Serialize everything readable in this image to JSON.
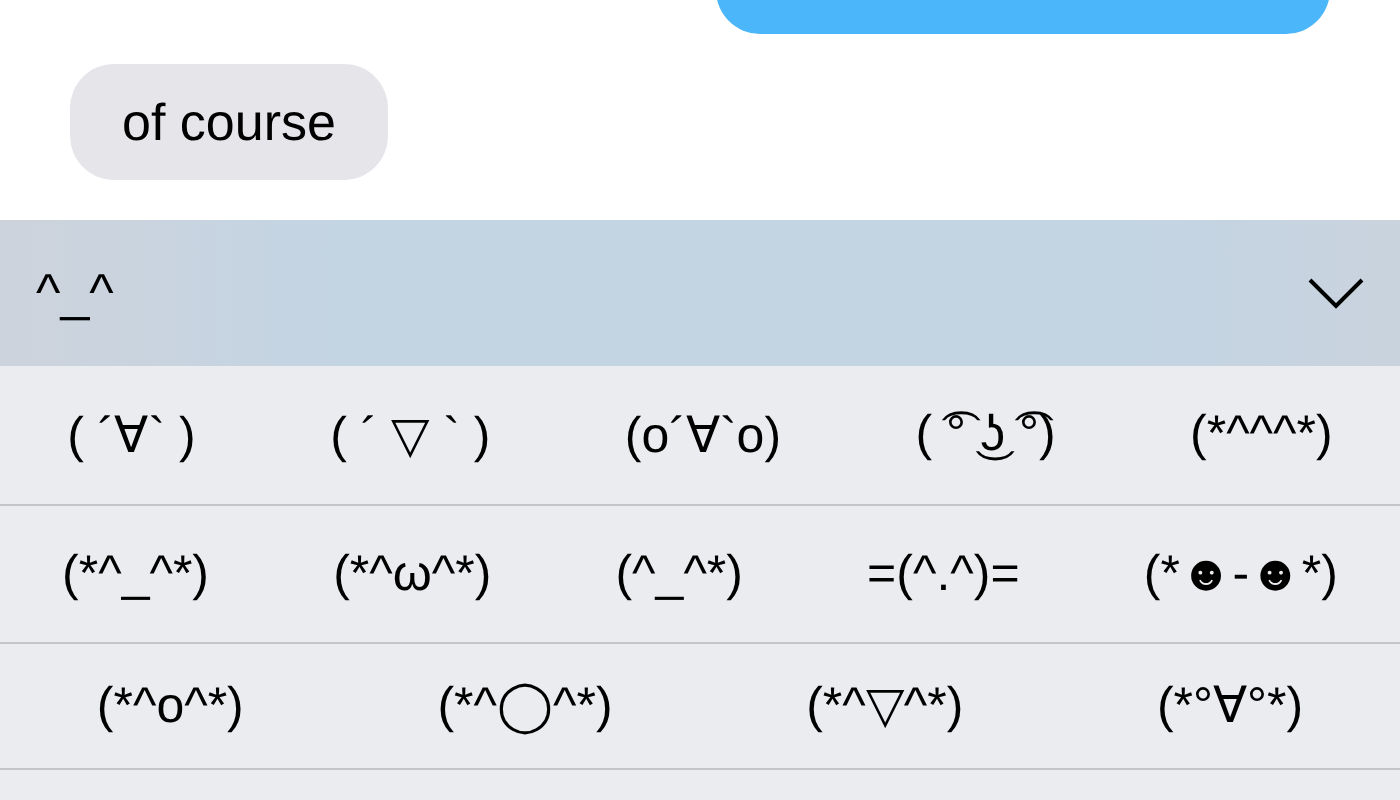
{
  "messages": [
    {
      "kind": "sent"
    },
    {
      "kind": "received",
      "text": "of course"
    }
  ],
  "suggestion_bar": {
    "current": "^_^"
  },
  "candidate_rows": [
    [
      "( ´∀` )",
      "( ´ ▽ ` )",
      "(o´∀`o)",
      "( ͡° ͜ʖ ͡°)",
      "(*^^^*)"
    ],
    [
      "(*^_^*)",
      "(*^ω^*)",
      "(^_^*)",
      "=(^.^)=",
      "(*☻-☻*)"
    ],
    [
      "(*^o^*)",
      "(*^◯^*)",
      "(*^▽^*)",
      "(*°∀°*)"
    ]
  ]
}
